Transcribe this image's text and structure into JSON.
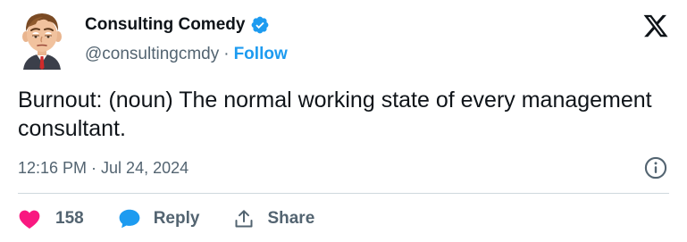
{
  "author": {
    "display_name": "Consulting Comedy",
    "handle": "@consultingcmdy",
    "separator": "·",
    "follow_label": "Follow"
  },
  "tweet": {
    "text": "Burnout: (noun) The normal working state of every management consultant.",
    "time": "12:16 PM",
    "separator": "·",
    "date": "Jul 24, 2024"
  },
  "actions": {
    "like_count": "158",
    "reply_label": "Reply",
    "share_label": "Share"
  },
  "colors": {
    "accent": "#1d9bf0",
    "like": "#f91880",
    "text_primary": "#0f1419",
    "text_secondary": "#536471",
    "divider": "#cfd9de"
  },
  "icons": {
    "verified": "verified-badge-icon",
    "brand": "x-logo-icon",
    "info": "info-icon",
    "like": "heart-icon",
    "reply": "speech-bubble-icon",
    "share": "share-upload-icon"
  }
}
